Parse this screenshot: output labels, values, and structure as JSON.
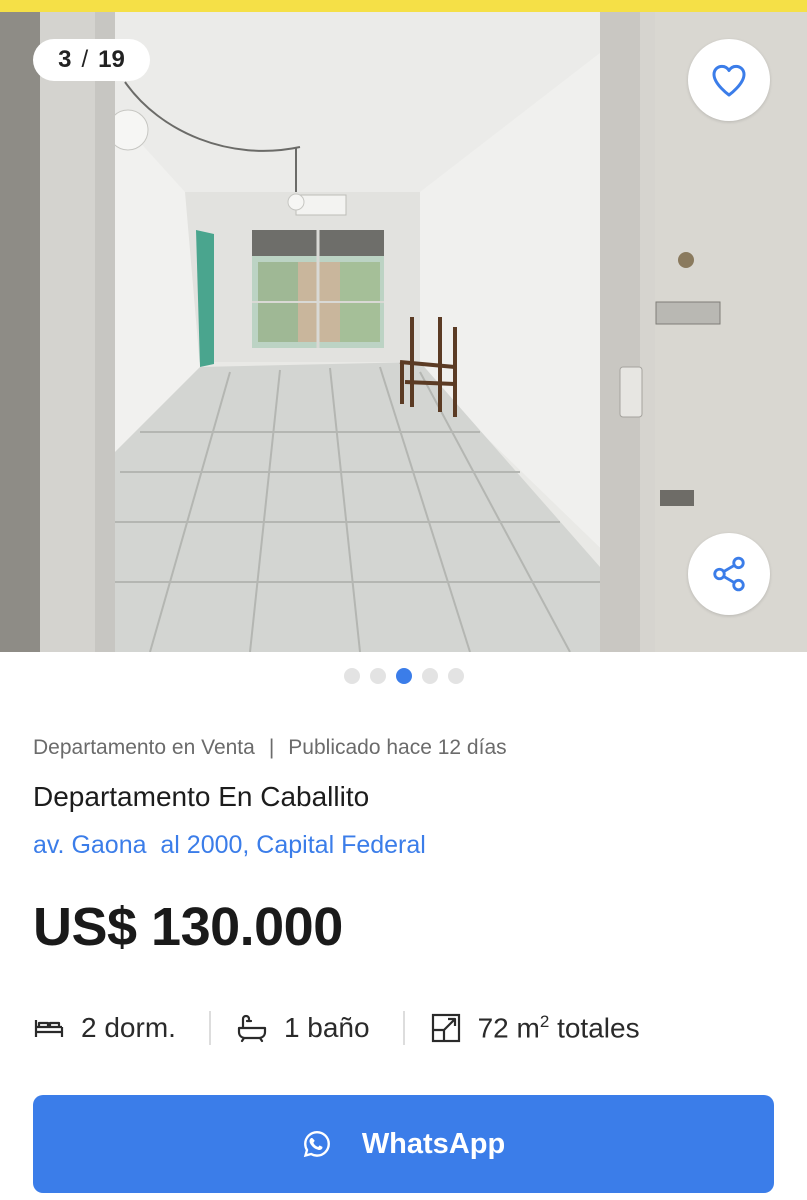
{
  "gallery": {
    "counter_current": "3",
    "counter_separator": "/",
    "counter_total": "19",
    "dots_total": 5,
    "active_dot_index": 2,
    "favorite_icon": "heart-icon",
    "share_icon": "share-icon"
  },
  "listing": {
    "operation": "Departamento en Venta",
    "separator": "|",
    "published": "Publicado hace 12 días",
    "title": "Departamento En Caballito",
    "address": "av. Gaona  al 2000, Capital Federal",
    "price": "US$ 130.000"
  },
  "features": {
    "bedrooms": "2 dorm.",
    "bathrooms": "1 baño",
    "area_value": "72 m",
    "area_sup": "2",
    "area_suffix": " totales"
  },
  "cta": {
    "whatsapp_label": "WhatsApp"
  },
  "colors": {
    "accent_blue": "#3b7de9",
    "top_bar_yellow": "#f5e047",
    "active_dot": "#3b7de9",
    "inactive_dot": "#e3e3e3"
  }
}
